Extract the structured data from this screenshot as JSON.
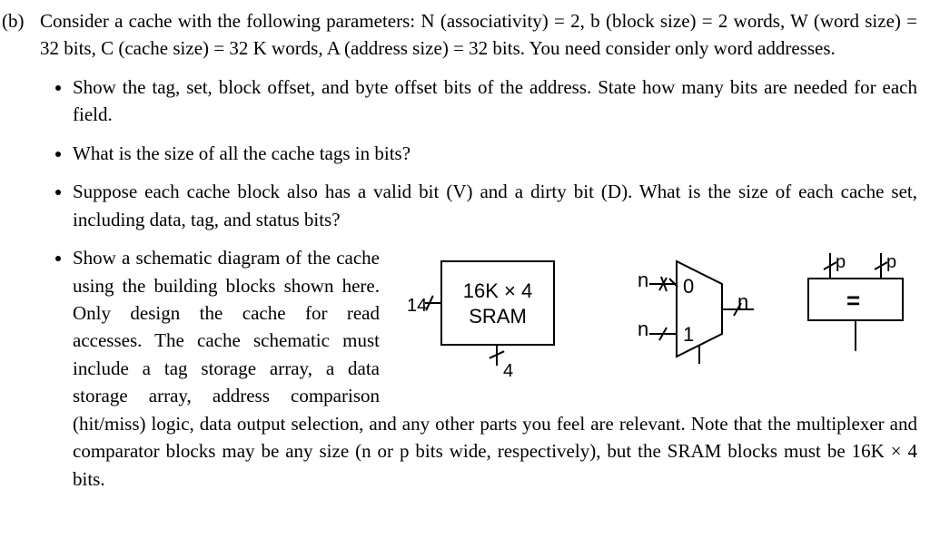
{
  "problem": {
    "label": "(b)",
    "intro": "Consider a cache with the following parameters: N (associativity) = 2, b (block size) = 2 words, W (word size) = 32 bits, C (cache size) = 32 K words, A (address size) = 32 bits. You need consider only word addresses.",
    "questions": [
      "Show the tag, set, block offset, and byte offset bits of the address. State how many bits are needed for each field.",
      "What is the size of all the cache tags in bits?",
      "Suppose each cache block also has a valid bit (V) and a dirty bit (D). What is the size of each cache set, including data, tag, and status bits?"
    ],
    "q4_pre": "Show a schematic diagram of the cache using the building blocks shown here. Only design the cache for read accesses. The cache schematic must include a tag storage array, a data storage array, address comparison (hit/miss) logic, data output selection, and any other parts you feel are relevant. Note that the multiplexer and comparator blocks",
    "q4_post": "may be any size (n or p bits wide, respectively), but the SRAM blocks must be 16K × 4 bits."
  },
  "figure": {
    "sram": {
      "line1": "16K × 4",
      "line2": "SRAM",
      "addr_bits": "14",
      "out_bits": "4"
    },
    "mux": {
      "in0": "0",
      "in1": "1",
      "bus": "n"
    },
    "cmp": {
      "bus": "p",
      "symbol": "="
    }
  }
}
